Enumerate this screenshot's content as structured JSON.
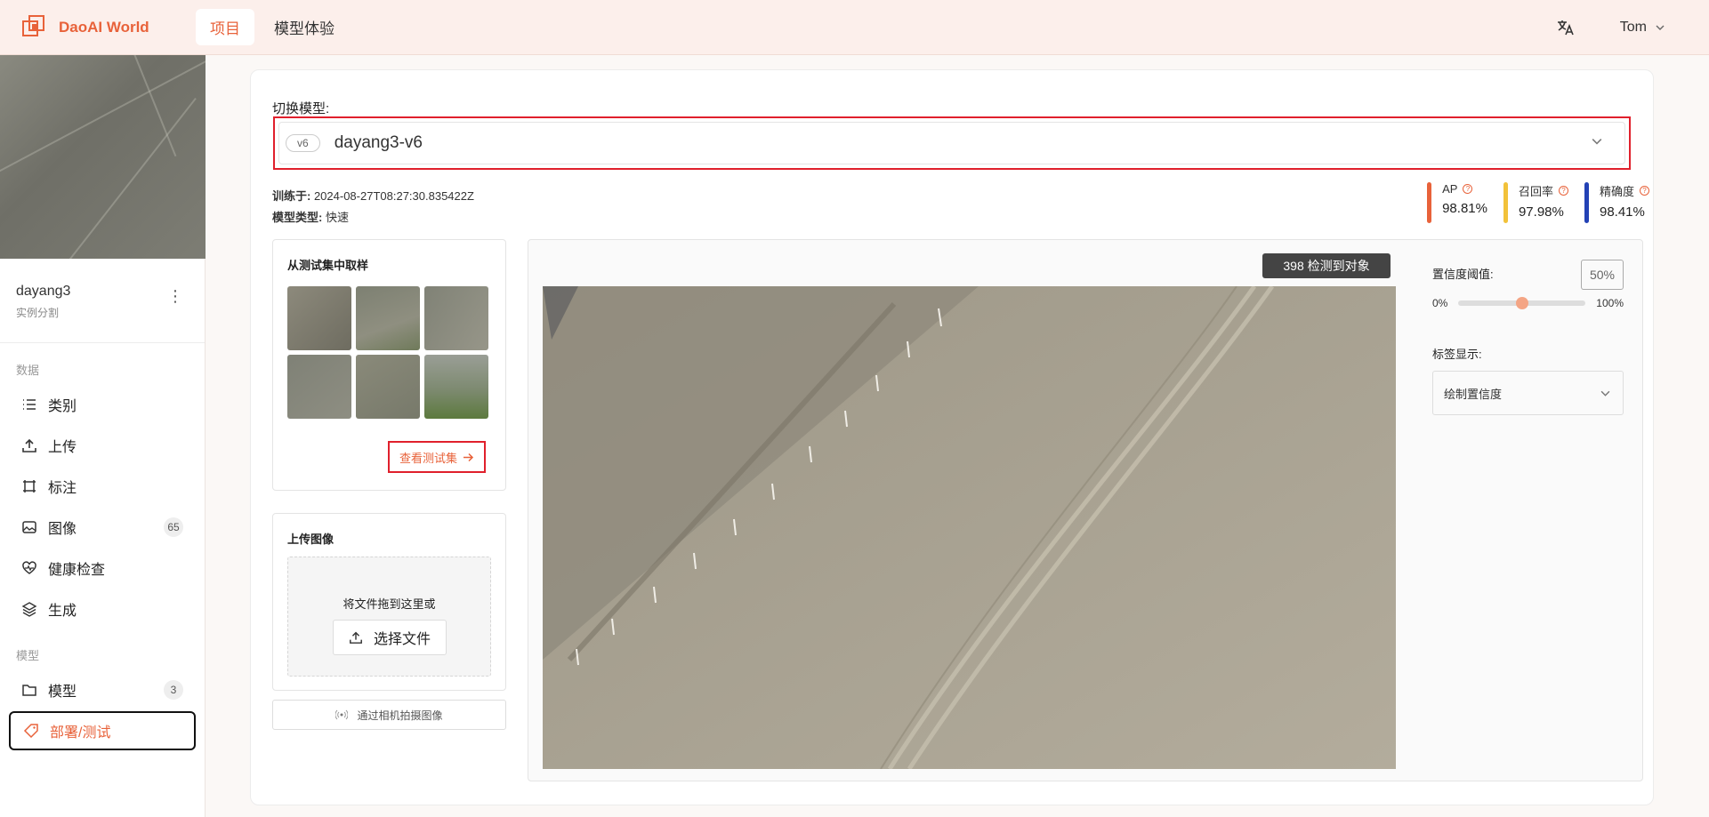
{
  "app": {
    "name": "DaoAI World"
  },
  "nav": {
    "items": [
      {
        "label": "项目",
        "active": true
      },
      {
        "label": "模型体验",
        "active": false
      }
    ]
  },
  "user": {
    "name": "Tom"
  },
  "project": {
    "name": "dayang3",
    "type": "实例分割"
  },
  "sidebar": {
    "data_section": "数据",
    "model_section": "模型",
    "items": [
      {
        "label": "类别",
        "icon": "list-icon"
      },
      {
        "label": "上传",
        "icon": "upload-icon"
      },
      {
        "label": "标注",
        "icon": "annotate-icon"
      },
      {
        "label": "图像",
        "icon": "image-icon",
        "badge": "65"
      },
      {
        "label": "健康检查",
        "icon": "heart-pulse-icon"
      },
      {
        "label": "生成",
        "icon": "layers-icon"
      },
      {
        "label": "模型",
        "icon": "folder-icon",
        "badge": "3"
      },
      {
        "label": "部署/测试",
        "icon": "tag-icon",
        "active": true
      }
    ]
  },
  "model_switch": {
    "label": "切换模型:",
    "version": "v6",
    "name": "dayang3-v6"
  },
  "meta": {
    "trained_label": "训练于: ",
    "trained_value": "2024-08-27T08:27:30.835422Z",
    "type_label": "模型类型: ",
    "type_value": "快速"
  },
  "metrics": [
    {
      "label": "AP",
      "value": "98.81%",
      "color": "#e8623a"
    },
    {
      "label": "召回率",
      "value": "97.98%",
      "color": "#f2c23a"
    },
    {
      "label": "精确度",
      "value": "98.41%",
      "color": "#2342b5"
    }
  ],
  "sample": {
    "title": "从测试集中取样",
    "view_label": "查看测试集"
  },
  "upload": {
    "title": "上传图像",
    "drop_text": "将文件拖到这里或",
    "choose_label": "选择文件"
  },
  "camera": {
    "label": "通过相机拍摄图像"
  },
  "preview": {
    "detect_badge": "398 检测到对象"
  },
  "settings": {
    "threshold_label": "置信度阈值:",
    "threshold_value": "50%",
    "threshold_fraction": 0.5,
    "min_label": "0%",
    "max_label": "100%",
    "label_display_label": "标签显示:",
    "label_display_value": "绘制置信度"
  }
}
